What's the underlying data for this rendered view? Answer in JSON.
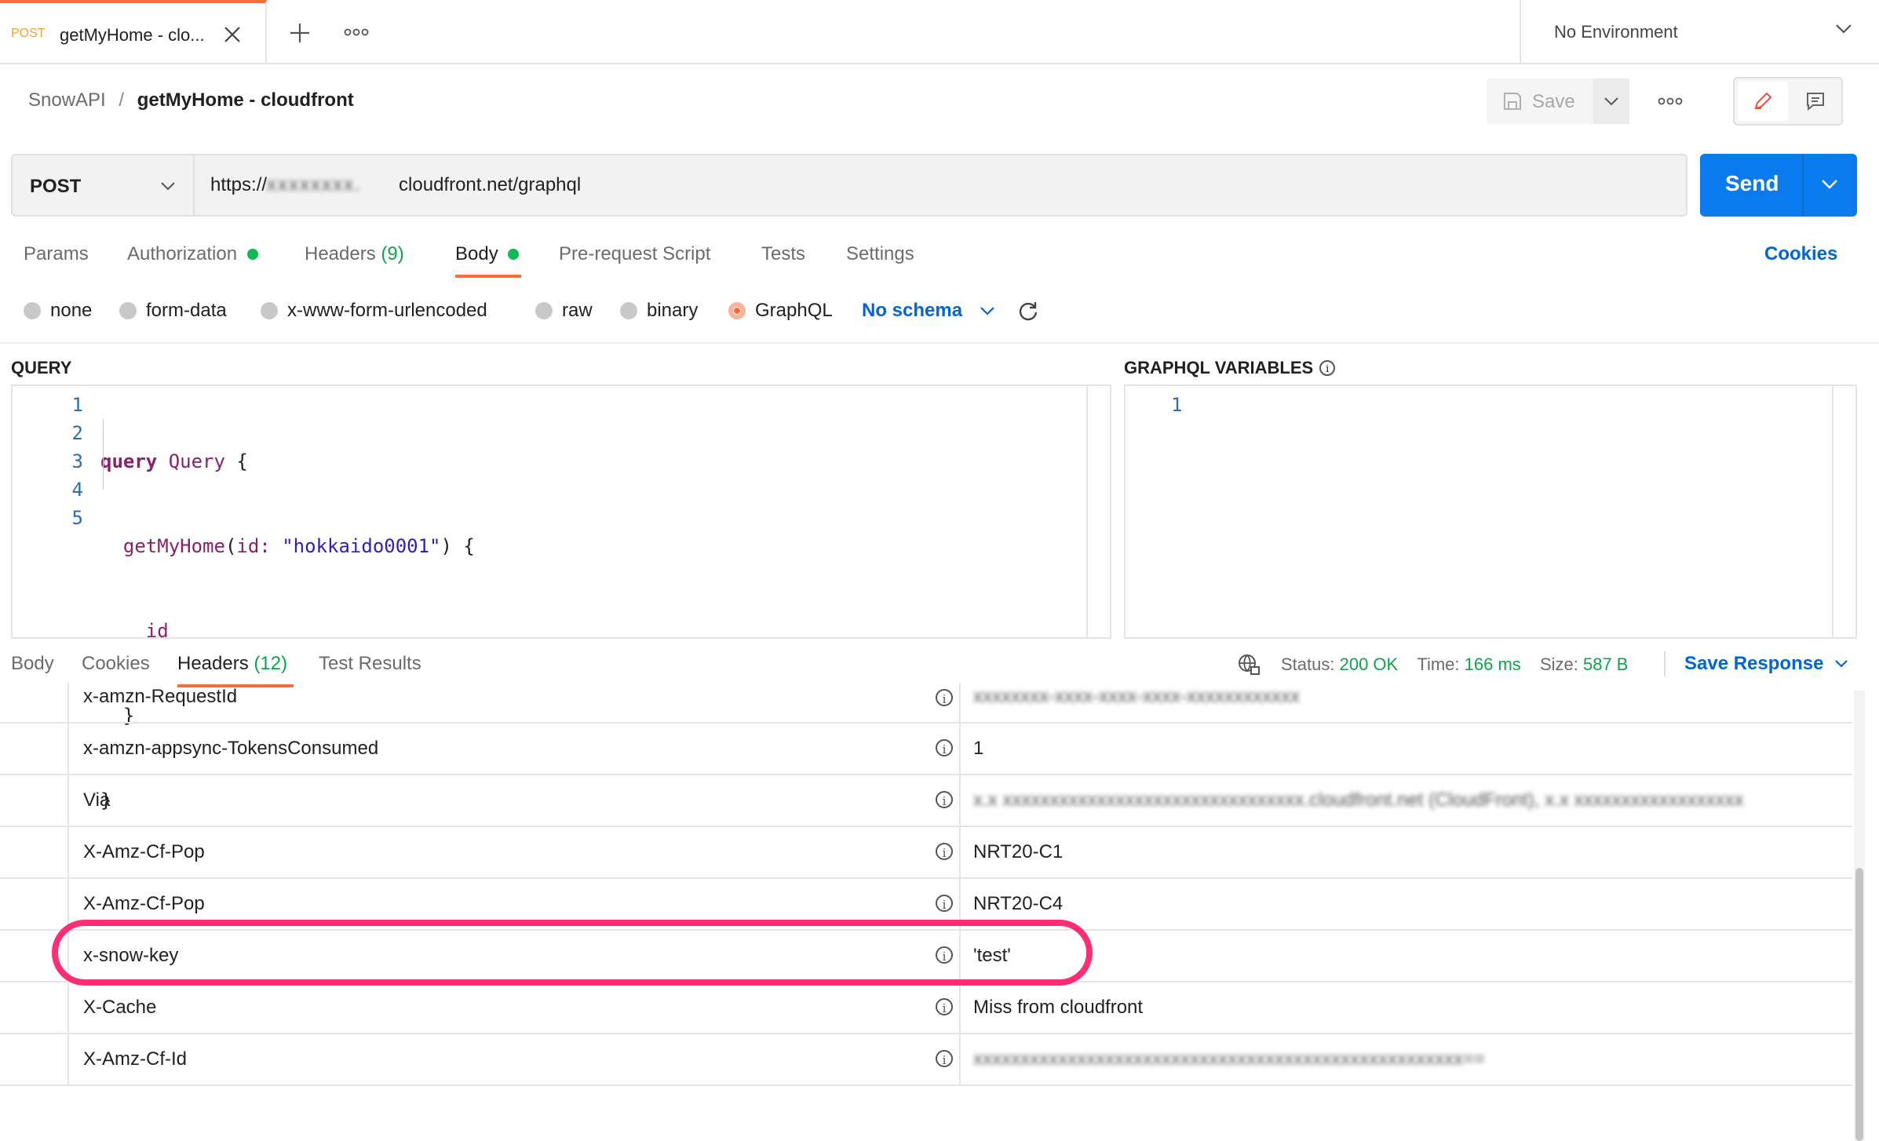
{
  "tab": {
    "method": "POST",
    "title": "getMyHome - clo..."
  },
  "environment": "No Environment",
  "breadcrumb": {
    "collection": "SnowAPI",
    "separator": "/",
    "request": "getMyHome - cloudfront"
  },
  "toolbar": {
    "save_label": "Save"
  },
  "request": {
    "method": "POST",
    "url_prefix": "https://",
    "url_hidden": "xxxxxxxx.",
    "url_suffix": "cloudfront.net/graphql",
    "send_label": "Send"
  },
  "request_tabs": [
    {
      "label": "Params"
    },
    {
      "label": "Authorization"
    },
    {
      "label": "Headers",
      "count": "(9)"
    },
    {
      "label": "Body"
    },
    {
      "label": "Pre-request Script"
    },
    {
      "label": "Tests"
    },
    {
      "label": "Settings"
    }
  ],
  "cookies_link": "Cookies",
  "body_types": [
    "none",
    "form-data",
    "x-www-form-urlencoded",
    "raw",
    "binary",
    "GraphQL"
  ],
  "schema_label": "No schema",
  "query": {
    "heading": "QUERY",
    "line_numbers": [
      "1",
      "2",
      "3",
      "4",
      "5"
    ],
    "l1_kw": "query",
    "l1_name": "Query",
    "l1_brace": "{",
    "l2_field": "getMyHome",
    "l2_open": "(",
    "l2_arg": "id:",
    "l2_str": "\"hokkaido0001\"",
    "l2_close": ") {",
    "l3": "id",
    "l4": "}",
    "l5": "}"
  },
  "variables": {
    "heading": "GRAPHQL VARIABLES",
    "line_number": "1"
  },
  "response_tabs": [
    {
      "label": "Body"
    },
    {
      "label": "Cookies"
    },
    {
      "label": "Headers",
      "count": "(12)"
    },
    {
      "label": "Test Results"
    }
  ],
  "status": {
    "status_label": "Status:",
    "status_value": "200 OK",
    "time_label": "Time:",
    "time_value": "166 ms",
    "size_label": "Size:",
    "size_value": "587 B",
    "save_response": "Save Response"
  },
  "headers": [
    {
      "key": "x-amzn-RequestId",
      "value": "xxxxxxxx-xxxx-xxxx-xxxx-xxxxxxxxxxxx"
    },
    {
      "key": "x-amzn-appsync-TokensConsumed",
      "value": "1"
    },
    {
      "key": "Via",
      "value": "x.x xxxxxxxxxxxxxxxxxxxxxxxxxxxxxxxx.cloudfront.net (CloudFront), x.x xxxxxxxxxxxxxxxxxx"
    },
    {
      "key": "X-Amz-Cf-Pop",
      "value": "NRT20-C1"
    },
    {
      "key": "X-Amz-Cf-Pop",
      "value": "NRT20-C4"
    },
    {
      "key": "x-snow-key",
      "value": "'test'"
    },
    {
      "key": "X-Cache",
      "value": "Miss from cloudfront"
    },
    {
      "key": "X-Amz-Cf-Id",
      "value": "xxxxxxxxxxxxxxxxxxxxxxxxxxxxxxxxxxxxxxxxxxxxxxxxxxxx=="
    }
  ],
  "colors": {
    "accent": "#ff6c37",
    "send": "#097bed",
    "highlight": "#ff2e74",
    "success": "#0cbb52",
    "link": "#0265d2"
  }
}
